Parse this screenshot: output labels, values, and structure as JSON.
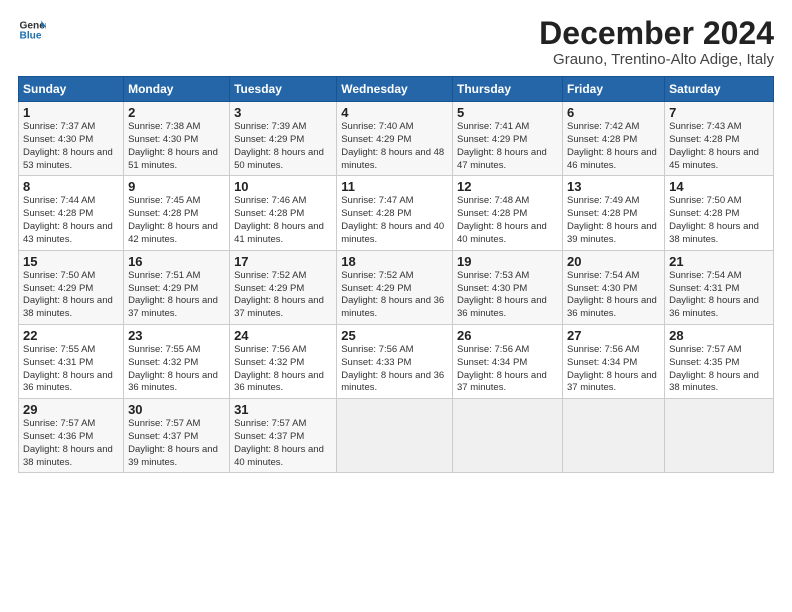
{
  "logo": {
    "line1": "General",
    "line2": "Blue"
  },
  "title": "December 2024",
  "subtitle": "Grauno, Trentino-Alto Adige, Italy",
  "header": {
    "days": [
      "Sunday",
      "Monday",
      "Tuesday",
      "Wednesday",
      "Thursday",
      "Friday",
      "Saturday"
    ]
  },
  "weeks": [
    [
      {
        "num": "1",
        "sunrise": "Sunrise: 7:37 AM",
        "sunset": "Sunset: 4:30 PM",
        "daylight": "Daylight: 8 hours and 53 minutes."
      },
      {
        "num": "2",
        "sunrise": "Sunrise: 7:38 AM",
        "sunset": "Sunset: 4:30 PM",
        "daylight": "Daylight: 8 hours and 51 minutes."
      },
      {
        "num": "3",
        "sunrise": "Sunrise: 7:39 AM",
        "sunset": "Sunset: 4:29 PM",
        "daylight": "Daylight: 8 hours and 50 minutes."
      },
      {
        "num": "4",
        "sunrise": "Sunrise: 7:40 AM",
        "sunset": "Sunset: 4:29 PM",
        "daylight": "Daylight: 8 hours and 48 minutes."
      },
      {
        "num": "5",
        "sunrise": "Sunrise: 7:41 AM",
        "sunset": "Sunset: 4:29 PM",
        "daylight": "Daylight: 8 hours and 47 minutes."
      },
      {
        "num": "6",
        "sunrise": "Sunrise: 7:42 AM",
        "sunset": "Sunset: 4:28 PM",
        "daylight": "Daylight: 8 hours and 46 minutes."
      },
      {
        "num": "7",
        "sunrise": "Sunrise: 7:43 AM",
        "sunset": "Sunset: 4:28 PM",
        "daylight": "Daylight: 8 hours and 45 minutes."
      }
    ],
    [
      {
        "num": "8",
        "sunrise": "Sunrise: 7:44 AM",
        "sunset": "Sunset: 4:28 PM",
        "daylight": "Daylight: 8 hours and 43 minutes."
      },
      {
        "num": "9",
        "sunrise": "Sunrise: 7:45 AM",
        "sunset": "Sunset: 4:28 PM",
        "daylight": "Daylight: 8 hours and 42 minutes."
      },
      {
        "num": "10",
        "sunrise": "Sunrise: 7:46 AM",
        "sunset": "Sunset: 4:28 PM",
        "daylight": "Daylight: 8 hours and 41 minutes."
      },
      {
        "num": "11",
        "sunrise": "Sunrise: 7:47 AM",
        "sunset": "Sunset: 4:28 PM",
        "daylight": "Daylight: 8 hours and 40 minutes."
      },
      {
        "num": "12",
        "sunrise": "Sunrise: 7:48 AM",
        "sunset": "Sunset: 4:28 PM",
        "daylight": "Daylight: 8 hours and 40 minutes."
      },
      {
        "num": "13",
        "sunrise": "Sunrise: 7:49 AM",
        "sunset": "Sunset: 4:28 PM",
        "daylight": "Daylight: 8 hours and 39 minutes."
      },
      {
        "num": "14",
        "sunrise": "Sunrise: 7:50 AM",
        "sunset": "Sunset: 4:28 PM",
        "daylight": "Daylight: 8 hours and 38 minutes."
      }
    ],
    [
      {
        "num": "15",
        "sunrise": "Sunrise: 7:50 AM",
        "sunset": "Sunset: 4:29 PM",
        "daylight": "Daylight: 8 hours and 38 minutes."
      },
      {
        "num": "16",
        "sunrise": "Sunrise: 7:51 AM",
        "sunset": "Sunset: 4:29 PM",
        "daylight": "Daylight: 8 hours and 37 minutes."
      },
      {
        "num": "17",
        "sunrise": "Sunrise: 7:52 AM",
        "sunset": "Sunset: 4:29 PM",
        "daylight": "Daylight: 8 hours and 37 minutes."
      },
      {
        "num": "18",
        "sunrise": "Sunrise: 7:52 AM",
        "sunset": "Sunset: 4:29 PM",
        "daylight": "Daylight: 8 hours and 36 minutes."
      },
      {
        "num": "19",
        "sunrise": "Sunrise: 7:53 AM",
        "sunset": "Sunset: 4:30 PM",
        "daylight": "Daylight: 8 hours and 36 minutes."
      },
      {
        "num": "20",
        "sunrise": "Sunrise: 7:54 AM",
        "sunset": "Sunset: 4:30 PM",
        "daylight": "Daylight: 8 hours and 36 minutes."
      },
      {
        "num": "21",
        "sunrise": "Sunrise: 7:54 AM",
        "sunset": "Sunset: 4:31 PM",
        "daylight": "Daylight: 8 hours and 36 minutes."
      }
    ],
    [
      {
        "num": "22",
        "sunrise": "Sunrise: 7:55 AM",
        "sunset": "Sunset: 4:31 PM",
        "daylight": "Daylight: 8 hours and 36 minutes."
      },
      {
        "num": "23",
        "sunrise": "Sunrise: 7:55 AM",
        "sunset": "Sunset: 4:32 PM",
        "daylight": "Daylight: 8 hours and 36 minutes."
      },
      {
        "num": "24",
        "sunrise": "Sunrise: 7:56 AM",
        "sunset": "Sunset: 4:32 PM",
        "daylight": "Daylight: 8 hours and 36 minutes."
      },
      {
        "num": "25",
        "sunrise": "Sunrise: 7:56 AM",
        "sunset": "Sunset: 4:33 PM",
        "daylight": "Daylight: 8 hours and 36 minutes."
      },
      {
        "num": "26",
        "sunrise": "Sunrise: 7:56 AM",
        "sunset": "Sunset: 4:34 PM",
        "daylight": "Daylight: 8 hours and 37 minutes."
      },
      {
        "num": "27",
        "sunrise": "Sunrise: 7:56 AM",
        "sunset": "Sunset: 4:34 PM",
        "daylight": "Daylight: 8 hours and 37 minutes."
      },
      {
        "num": "28",
        "sunrise": "Sunrise: 7:57 AM",
        "sunset": "Sunset: 4:35 PM",
        "daylight": "Daylight: 8 hours and 38 minutes."
      }
    ],
    [
      {
        "num": "29",
        "sunrise": "Sunrise: 7:57 AM",
        "sunset": "Sunset: 4:36 PM",
        "daylight": "Daylight: 8 hours and 38 minutes."
      },
      {
        "num": "30",
        "sunrise": "Sunrise: 7:57 AM",
        "sunset": "Sunset: 4:37 PM",
        "daylight": "Daylight: 8 hours and 39 minutes."
      },
      {
        "num": "31",
        "sunrise": "Sunrise: 7:57 AM",
        "sunset": "Sunset: 4:37 PM",
        "daylight": "Daylight: 8 hours and 40 minutes."
      },
      null,
      null,
      null,
      null
    ]
  ]
}
